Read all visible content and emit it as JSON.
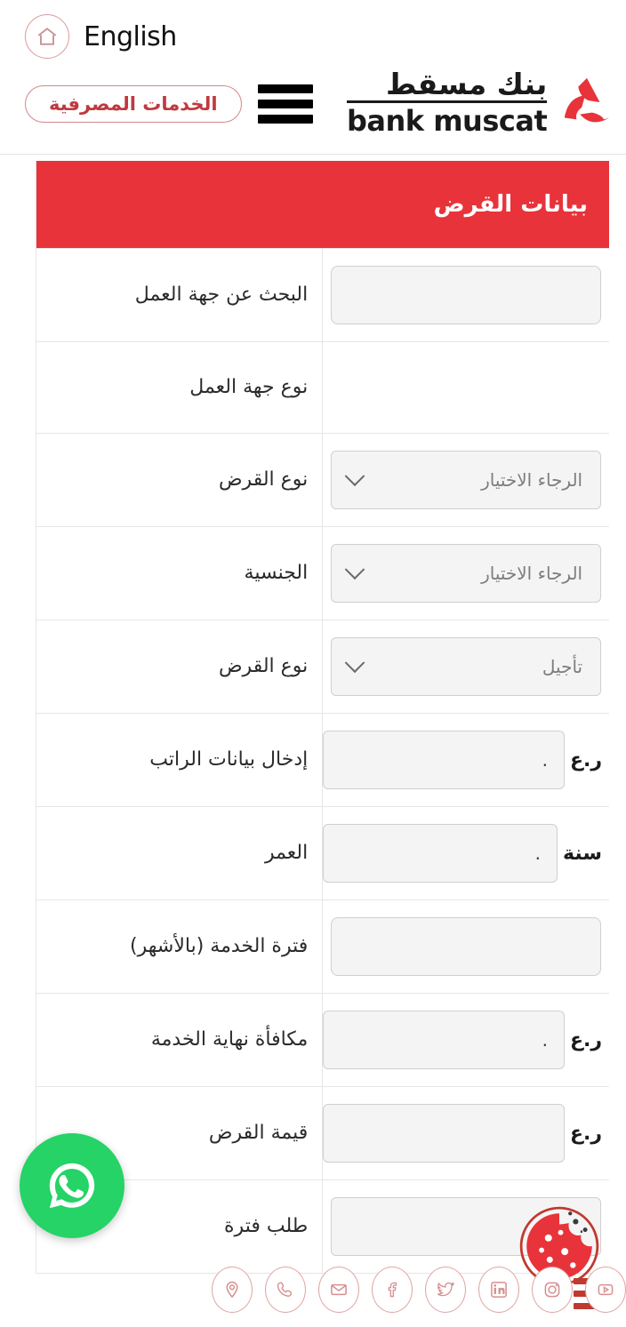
{
  "header": {
    "language_label": "English",
    "home_icon": "home-icon",
    "menu_icon": "hamburger-menu-icon",
    "banking_services_label": "الخدمات المصرفية",
    "logo_arabic": "بنك مسقط",
    "logo_english": "bank muscat"
  },
  "table": {
    "title": "بيانات القرض",
    "rows": [
      {
        "label": "البحث عن جهة العمل",
        "control": "text",
        "value": "",
        "unit": ""
      },
      {
        "label": "نوع جهة العمل",
        "control": "none",
        "value": "",
        "unit": ""
      },
      {
        "label": "نوع القرض",
        "control": "select",
        "value": "الرجاء الاختيار",
        "unit": ""
      },
      {
        "label": "الجنسية",
        "control": "select",
        "value": "الرجاء الاختيار",
        "unit": ""
      },
      {
        "label": "نوع القرض",
        "control": "select",
        "value": "تأجيل",
        "unit": ""
      },
      {
        "label": "إدخال بيانات الراتب",
        "control": "number",
        "value": ".",
        "unit": "ر.ع"
      },
      {
        "label": "العمر",
        "control": "number",
        "value": ".",
        "unit": "سنة"
      },
      {
        "label": "فترة الخدمة (بالأشهر)",
        "control": "text",
        "value": "",
        "unit": ""
      },
      {
        "label": "مكافأة نهاية الخدمة",
        "control": "number",
        "value": ".",
        "unit": "ر.ع"
      },
      {
        "label": "قيمة القرض",
        "control": "number",
        "value": "",
        "unit": "ر.ع"
      },
      {
        "label": "طلب فترة",
        "control": "number",
        "value": ".",
        "unit": ""
      }
    ]
  },
  "floating": {
    "whatsapp_icon": "whatsapp-icon",
    "cookie_icon": "cookie-consent-icon",
    "side_menu_icon": "hamburger-menu-icon"
  },
  "social": {
    "items": [
      {
        "icon": "youtube-icon"
      },
      {
        "icon": "instagram-icon"
      },
      {
        "icon": "linkedin-icon"
      },
      {
        "icon": "twitter-icon"
      },
      {
        "icon": "facebook-icon"
      },
      {
        "icon": "email-icon"
      },
      {
        "icon": "phone-icon"
      },
      {
        "icon": "location-pin-icon"
      }
    ]
  },
  "colors": {
    "brand_red": "#e8333a",
    "accent_red": "#c0392f",
    "whatsapp_green": "#25d366",
    "field_bg": "#f4f4f4",
    "border": "#e6e6e6"
  }
}
